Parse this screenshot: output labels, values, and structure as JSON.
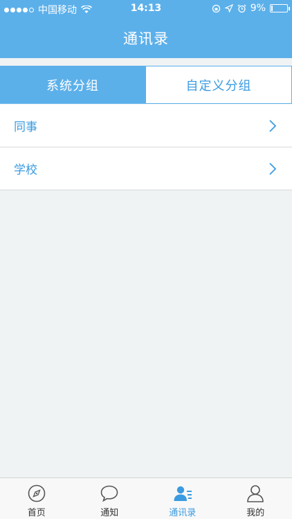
{
  "statusbar": {
    "carrier": "中国移动",
    "time": "14:13",
    "battery": "9%",
    "battery_level": 0.09
  },
  "header": {
    "title": "通讯录"
  },
  "segments": [
    {
      "label": "系统分组",
      "active": true
    },
    {
      "label": "自定义分组",
      "active": false
    }
  ],
  "list": [
    {
      "label": "同事"
    },
    {
      "label": "学校"
    }
  ],
  "tabbar": [
    {
      "label": "首页",
      "icon": "compass-icon",
      "active": false
    },
    {
      "label": "通知",
      "icon": "chat-bubble-icon",
      "active": false
    },
    {
      "label": "通讯录",
      "icon": "contacts-icon",
      "active": true
    },
    {
      "label": "我的",
      "icon": "person-icon",
      "active": false
    }
  ],
  "colors": {
    "primary": "#5cb0ea",
    "link": "#3a9be0",
    "background": "#eff3f4"
  }
}
